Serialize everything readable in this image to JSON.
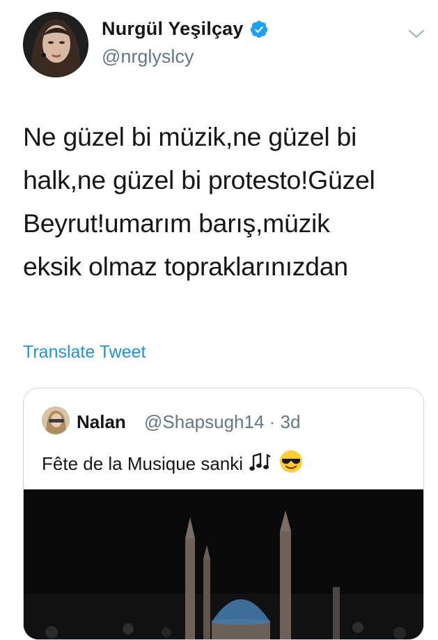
{
  "author": {
    "name": "Nurgül Yeşilçay",
    "handle": "@nrglyslcy"
  },
  "tweet": {
    "lines": [
      "Ne güzel bi müzik,ne güzel bi",
      "halk,ne güzel bi protesto!Güzel",
      "Beyrut!umarım barış,müzik",
      "eksik olmaz topraklarınızdan"
    ]
  },
  "translate_label": "Translate Tweet",
  "quoted": {
    "name": "Nalan",
    "meta": "@Shapsugh14 · 3d",
    "text": "Fête de la Musique sanki",
    "emojis": [
      "musical-notes-icon",
      "sunglasses-face-icon"
    ]
  },
  "colors": {
    "link": "#1b95e0",
    "verified": "#1da1f2",
    "secondary_text": "#657786",
    "border": "#ccd6dd"
  }
}
